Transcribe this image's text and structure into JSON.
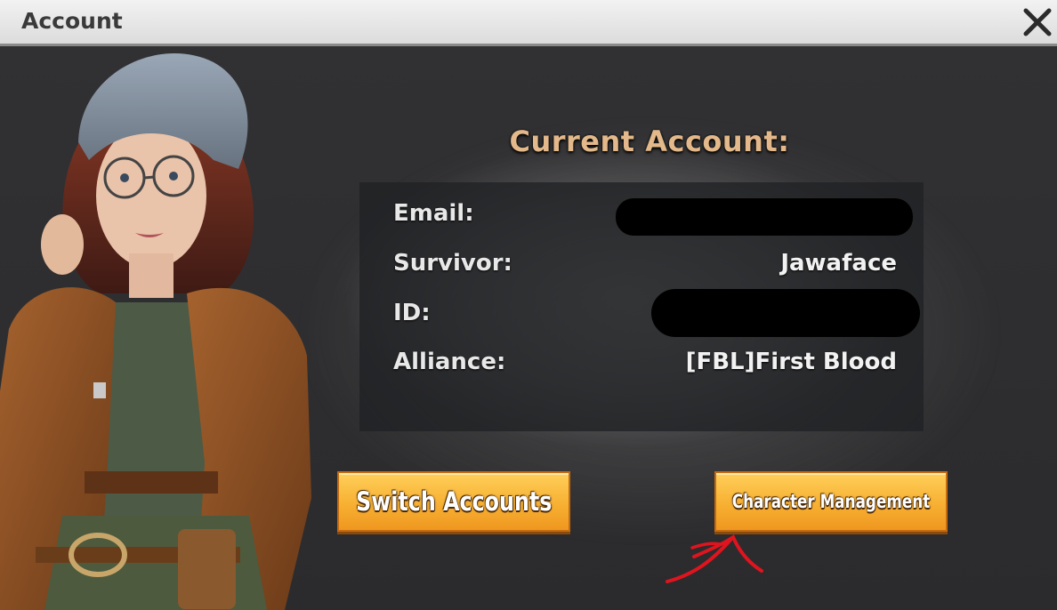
{
  "window": {
    "title": "Account",
    "close_icon": "close-icon"
  },
  "account": {
    "heading": "Current Account:",
    "rows": [
      {
        "label": "Email:",
        "value": "",
        "redacted": true
      },
      {
        "label": "Survivor:",
        "value": "Jawaface",
        "redacted": false
      },
      {
        "label": "ID:",
        "value": "",
        "redacted": true
      },
      {
        "label": "Alliance:",
        "value": "[FBL]First Blood",
        "redacted": false
      }
    ]
  },
  "buttons": {
    "switch_accounts": "Switch Accounts",
    "character_management": "Character Management"
  },
  "colors": {
    "heading": "#e3b88a",
    "button": "#f7b032",
    "annotation": "#e0141e"
  }
}
